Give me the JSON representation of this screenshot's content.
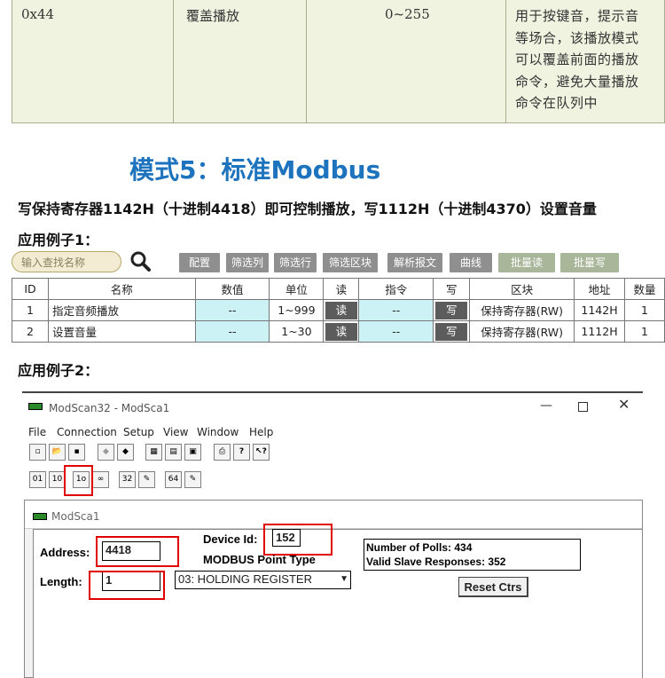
{
  "param_table": {
    "code": "0x44",
    "name": "覆盖播放",
    "range": "0~255",
    "desc_lines": [
      "用于按键音，提示音",
      "等场合，该播放模式",
      "可以覆盖前面的播放",
      "命令，避免大量播放",
      "命令在队列中"
    ]
  },
  "mode_title": "模式5：标准Modbus",
  "intro_text": "写保持寄存器1142H（十进制4418）即可控制播放，写1112H（十进制4370）设置音量",
  "example1_title": "应用例子1：",
  "example2_title": "应用例子2：",
  "toolbar": {
    "search_placeholder": "输入查找名称",
    "buttons": [
      "配置",
      "筛选列",
      "筛选行",
      "筛选区块",
      "解析报文",
      "曲线",
      "批量读",
      "批量写"
    ]
  },
  "grid": {
    "headers": [
      "ID",
      "名称",
      "数值",
      "单位",
      "读",
      "指令",
      "写",
      "区块",
      "地址",
      "数量"
    ],
    "rows": [
      [
        "1",
        "指定音频播放",
        "--",
        "1~999",
        "读",
        "--",
        "写",
        "保持寄存器(RW)",
        "1142H",
        "1"
      ],
      [
        "2",
        "设置音量",
        "--",
        "1~30",
        "读",
        "--",
        "写",
        "保持寄存器(RW)",
        "1112H",
        "1"
      ]
    ]
  },
  "modscan": {
    "window_title": "ModScan32 - ModSca1",
    "menu": [
      "File",
      "Connection",
      "Setup",
      "View",
      "Window",
      "Help"
    ],
    "child_title": "ModSca1",
    "address_label": "Address:",
    "address_value": "4418",
    "device_id_label": "Device Id:",
    "device_id_value": "152",
    "point_type_label": "MODBUS Point Type",
    "length_label": "Length:",
    "length_value": "1",
    "point_type_value": "03: HOLDING REGISTER",
    "polls_label": "Number of Polls: 434",
    "valid_label": "Valid Slave Responses: 352",
    "reset_label": "Reset Ctrs"
  }
}
